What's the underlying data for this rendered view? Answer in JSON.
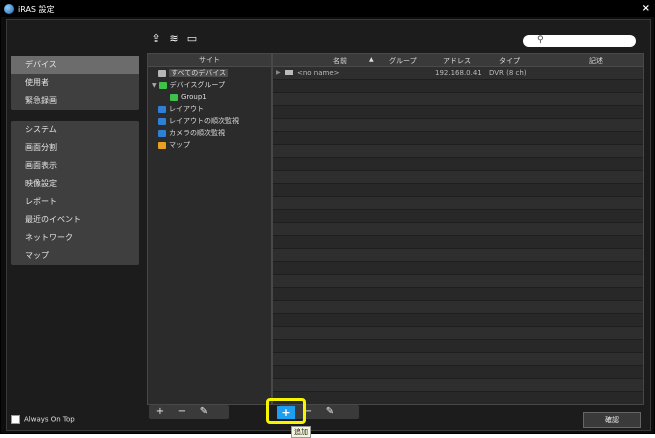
{
  "window": {
    "title": "iRAS 設定",
    "close_label": "×"
  },
  "nav_group1": [
    "デバイス",
    "使用者",
    "緊急録画"
  ],
  "nav_group2": [
    "システム",
    "画面分割",
    "画面表示",
    "映像設定",
    "レポート",
    "最近のイベント",
    "ネットワーク",
    "マップ"
  ],
  "always_on_top_label": "Always On Top",
  "toolbar_icons": [
    "upload-icon",
    "wifi-icon",
    "folder-icon"
  ],
  "search": {
    "placeholder": ""
  },
  "tree": {
    "header": "サイト",
    "nodes": [
      {
        "label": "すべてのデバイス",
        "icon": "all-devices-icon",
        "selected": true
      },
      {
        "label": "デバイスグループ",
        "icon": "device-group-icon"
      },
      {
        "label": "Group1",
        "icon": "group-icon"
      },
      {
        "label": "レイアウト",
        "icon": "layout-icon"
      },
      {
        "label": "レイアウトの順次監視",
        "icon": "layout-sequence-icon"
      },
      {
        "label": "カメラの順次監視",
        "icon": "camera-sequence-icon"
      },
      {
        "label": "マップ",
        "icon": "map-icon"
      }
    ]
  },
  "list": {
    "headers": {
      "name": "名前",
      "sort": "▲",
      "group": "グループ",
      "address": "アドレス",
      "type": "タイプ",
      "note": "記述"
    },
    "rows": [
      {
        "name": "<no name>",
        "group": "",
        "address": "192.168.0.41",
        "type": "DVR (8 ch)",
        "note": ""
      }
    ]
  },
  "buttons": {
    "add": "+",
    "remove": "−",
    "edit": "✎",
    "confirm": "確認",
    "tooltip": "追加"
  },
  "colors": {
    "highlight": "#f5f500",
    "add_button": "#1e9ef0"
  }
}
